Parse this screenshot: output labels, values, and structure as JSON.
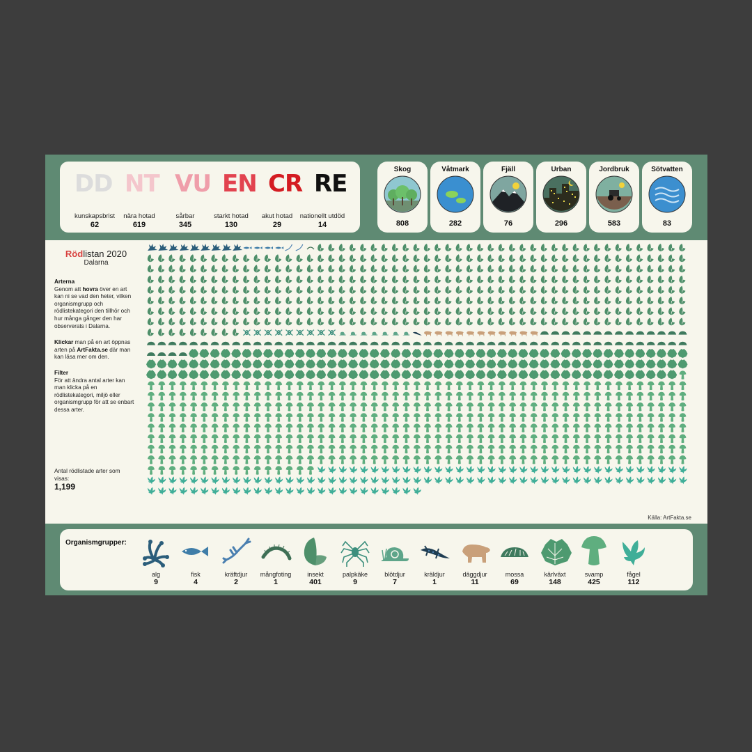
{
  "categories": [
    {
      "code": "DD",
      "name": "kunskapsbrist",
      "count": "62",
      "color": "#dcdcdc"
    },
    {
      "code": "NT",
      "name": "nära hotad",
      "count": "619",
      "color": "#f4c6cc"
    },
    {
      "code": "VU",
      "name": "sårbar",
      "count": "345",
      "color": "#ef9eaa"
    },
    {
      "code": "EN",
      "name": "starkt hotad",
      "count": "130",
      "color": "#e2434f"
    },
    {
      "code": "CR",
      "name": "akut hotad",
      "count": "29",
      "color": "#d41c22"
    },
    {
      "code": "RE",
      "name": "nationellt utdöd",
      "count": "14",
      "color": "#111111"
    }
  ],
  "environments": [
    {
      "title": "Skog",
      "count": "808",
      "icon": "forest-icon"
    },
    {
      "title": "Våtmark",
      "count": "282",
      "icon": "wetland-icon"
    },
    {
      "title": "Fjäll",
      "count": "76",
      "icon": "mountain-icon"
    },
    {
      "title": "Urban",
      "count": "296",
      "icon": "city-icon"
    },
    {
      "title": "Jordbruk",
      "count": "583",
      "icon": "tractor-icon"
    },
    {
      "title": "Sötvatten",
      "count": "83",
      "icon": "water-icon"
    }
  ],
  "sidebar": {
    "title_red": "Röd",
    "title_rest": "listan 2020",
    "region": "Dalarna",
    "arterna_heading": "Arterna",
    "arterna_t1": "Genom att ",
    "arterna_bold": "hovra",
    "arterna_t2": " över en art kan ni se vad den heter, vilken organismgrupp och rödlistekategori den tillhör och hur många gånger den har observerats i Dalarna.",
    "click_bold": "Klickar",
    "click_t1": " man på en art öppnas arten på ",
    "click_link": "ArtFakta.se",
    "click_t2": " där man kan läsa mer om den.",
    "filter_heading": "Filter",
    "filter_text": "För att ändra antal arter kan man klicka på en rödlistekategori, miljö eller organismgrupp för att se enbart dessa arter.",
    "count_label": "Antal rödlistade arter som visas:",
    "count_value": "1,199"
  },
  "source": "Källa: ArtFakta.se",
  "organism_label": "Organismgrupper:",
  "organisms": [
    {
      "name": "alg",
      "count": "9",
      "color": "#2b5d7a",
      "icon": "alga-icon"
    },
    {
      "name": "fisk",
      "count": "4",
      "color": "#3f7da8",
      "icon": "fish-icon"
    },
    {
      "name": "kräftdjur",
      "count": "2",
      "color": "#4a7fb0",
      "icon": "crayfish-icon"
    },
    {
      "name": "mångfoting",
      "count": "1",
      "color": "#3e6f55",
      "icon": "centipede-icon"
    },
    {
      "name": "insekt",
      "count": "401",
      "color": "#4e8f6a",
      "icon": "butterfly-icon"
    },
    {
      "name": "palpkäke",
      "count": "9",
      "color": "#3c8f7d",
      "icon": "spider-icon"
    },
    {
      "name": "blötdjur",
      "count": "7",
      "color": "#5ea58a",
      "icon": "snail-icon"
    },
    {
      "name": "kräldjur",
      "count": "1",
      "color": "#1f3d52",
      "icon": "lizard-icon"
    },
    {
      "name": "däggdjur",
      "count": "11",
      "color": "#c9a07a",
      "icon": "bear-icon"
    },
    {
      "name": "mossa",
      "count": "69",
      "color": "#3f7a5e",
      "icon": "moss-icon"
    },
    {
      "name": "kärlväxt",
      "count": "148",
      "color": "#4e9a70",
      "icon": "plant-icon"
    },
    {
      "name": "svamp",
      "count": "425",
      "color": "#5fae7f",
      "icon": "mushroom-icon"
    },
    {
      "name": "fågel",
      "count": "112",
      "color": "#3fae98",
      "icon": "bird-icon"
    }
  ]
}
